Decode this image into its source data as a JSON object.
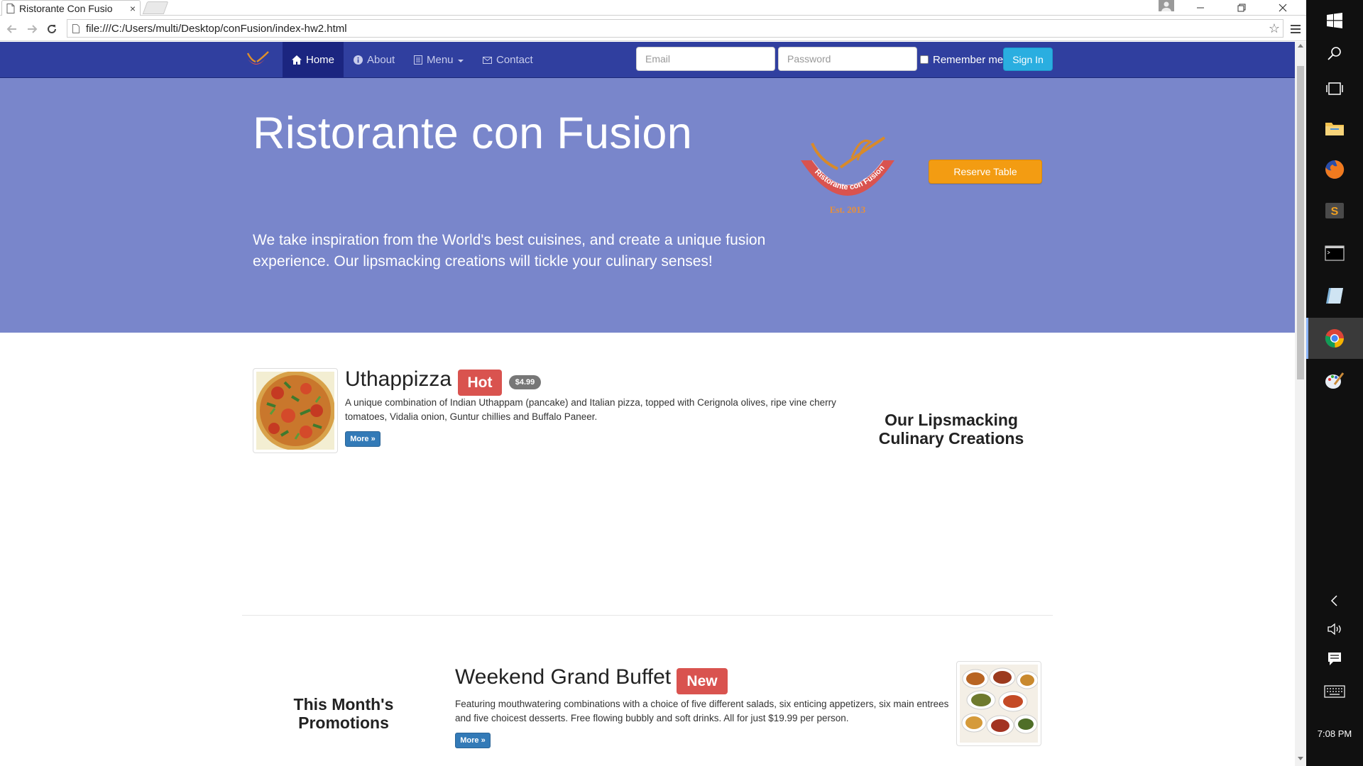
{
  "browser": {
    "tab_title": "Ristorante Con Fusio",
    "tab_close": "×",
    "url": "file:///C:/Users/multi/Desktop/conFusion/index-hw2.html"
  },
  "site": {
    "nav": {
      "home": "Home",
      "about": "About",
      "menu": "Menu",
      "contact": "Contact"
    },
    "login": {
      "email_placeholder": "Email",
      "password_placeholder": "Password",
      "remember_label": "Remember me",
      "sign_in": "Sign In"
    },
    "jumbotron": {
      "title": "Ristorante con Fusion",
      "text": "We take inspiration from the World's best cuisines, and create a unique fusion experience. Our lipsmacking creations will tickle your culinary senses!",
      "reserve_button": "Reserve Table",
      "logo_text": "Ristorante con Fusion",
      "logo_est": "Est. 2013"
    },
    "featured_dish": {
      "name": "Uthappizza",
      "badge": "Hot",
      "price": "$4.99",
      "description": "A unique combination of Indian Uthappam (pancake) and Italian pizza, topped with Cerignola olives, ripe vine cherry tomatoes, Vidalia onion, Guntur chillies and Buffalo Paneer.",
      "more": "More »",
      "side_heading": "Our Lipsmacking Culinary Creations"
    },
    "promotion": {
      "side_heading": "This Month's Promotions",
      "name": "Weekend Grand Buffet",
      "badge": "New",
      "description": "Featuring mouthwatering combinations with a choice of five different salads, six enticing appetizers, six main entrees and five choicest desserts. Free flowing bubbly and soft drinks. All for just $19.99 per person.",
      "more": "More »"
    }
  },
  "taskbar": {
    "clock": "7:08 PM",
    "apps": [
      "start-icon",
      "search-icon",
      "task-view-icon",
      "file-explorer-icon",
      "firefox-icon",
      "sublime-text-icon",
      "terminal-icon",
      "notes-icon",
      "chrome-icon",
      "paint-icon"
    ]
  },
  "colors": {
    "navbar": "#303F9F",
    "jumbotron": "#7986CB",
    "reserve": "#f39c12",
    "sign_in": "#2aaee0",
    "badge": "#d9534f",
    "more": "#337ab7"
  }
}
